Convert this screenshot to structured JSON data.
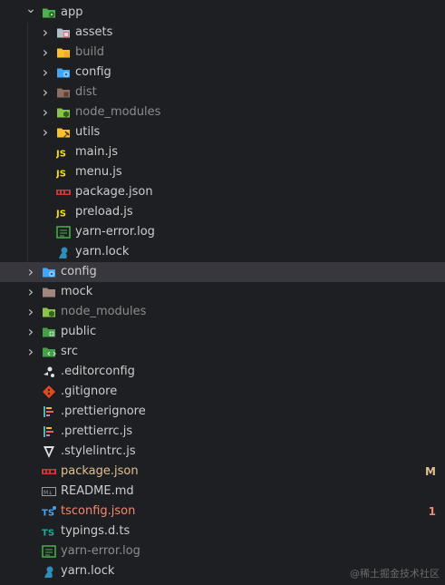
{
  "colors": {
    "background": "#1e1f22",
    "selected_row": "#37373d",
    "modified": "#e2c08d",
    "error": "#f48771",
    "ignored": "#8c8c8c",
    "normal": "#cccccc"
  },
  "tree": [
    {
      "label": "app",
      "chevron": "down",
      "icon": "folder-app-icon",
      "status": "normal"
    },
    {
      "label": "assets",
      "chevron": "right",
      "icon": "folder-assets-icon",
      "status": "normal"
    },
    {
      "label": "build",
      "chevron": "right",
      "icon": "folder-build-icon",
      "status": "ignored"
    },
    {
      "label": "config",
      "chevron": "right",
      "icon": "folder-config-icon",
      "status": "normal"
    },
    {
      "label": "dist",
      "chevron": "right",
      "icon": "folder-dist-icon",
      "status": "ignored"
    },
    {
      "label": "node_modules",
      "chevron": "right",
      "icon": "folder-node-modules-icon",
      "status": "ignored"
    },
    {
      "label": "utils",
      "chevron": "right",
      "icon": "folder-utils-icon",
      "status": "normal"
    },
    {
      "label": "main.js",
      "icon": "js-file-icon",
      "status": "normal"
    },
    {
      "label": "menu.js",
      "icon": "js-file-icon",
      "status": "normal"
    },
    {
      "label": "package.json",
      "icon": "npm-file-icon",
      "status": "normal"
    },
    {
      "label": "preload.js",
      "icon": "js-file-icon",
      "status": "normal"
    },
    {
      "label": "yarn-error.log",
      "icon": "log-file-icon",
      "status": "normal"
    },
    {
      "label": "yarn.lock",
      "icon": "yarn-file-icon",
      "status": "normal"
    },
    {
      "label": "config",
      "chevron": "right",
      "icon": "folder-config-icon",
      "status": "normal",
      "selected": true
    },
    {
      "label": "mock",
      "chevron": "right",
      "icon": "folder-mock-icon",
      "status": "normal"
    },
    {
      "label": "node_modules",
      "chevron": "right",
      "icon": "folder-node-modules-icon",
      "status": "ignored"
    },
    {
      "label": "public",
      "chevron": "right",
      "icon": "folder-public-icon",
      "status": "normal"
    },
    {
      "label": "src",
      "chevron": "right",
      "icon": "folder-src-icon",
      "status": "normal"
    },
    {
      "label": ".editorconfig",
      "icon": "editorconfig-file-icon",
      "status": "normal"
    },
    {
      "label": ".gitignore",
      "icon": "git-file-icon",
      "status": "normal"
    },
    {
      "label": ".prettierignore",
      "icon": "prettier-file-icon",
      "status": "normal"
    },
    {
      "label": ".prettierrc.js",
      "icon": "prettier-file-icon",
      "status": "normal"
    },
    {
      "label": ".stylelintrc.js",
      "icon": "stylelint-file-icon",
      "status": "normal"
    },
    {
      "label": "package.json",
      "icon": "npm-file-icon",
      "status": "modified",
      "badge": "M"
    },
    {
      "label": "README.md",
      "icon": "markdown-file-icon",
      "status": "normal"
    },
    {
      "label": "tsconfig.json",
      "icon": "tsconfig-file-icon",
      "status": "error",
      "badge": "1"
    },
    {
      "label": "typings.d.ts",
      "icon": "ts-file-icon",
      "status": "normal"
    },
    {
      "label": "yarn-error.log",
      "icon": "log-file-icon",
      "status": "ignored"
    },
    {
      "label": "yarn.lock",
      "icon": "yarn-file-icon",
      "status": "normal"
    }
  ],
  "watermark": "@稀土掘金技术社区"
}
